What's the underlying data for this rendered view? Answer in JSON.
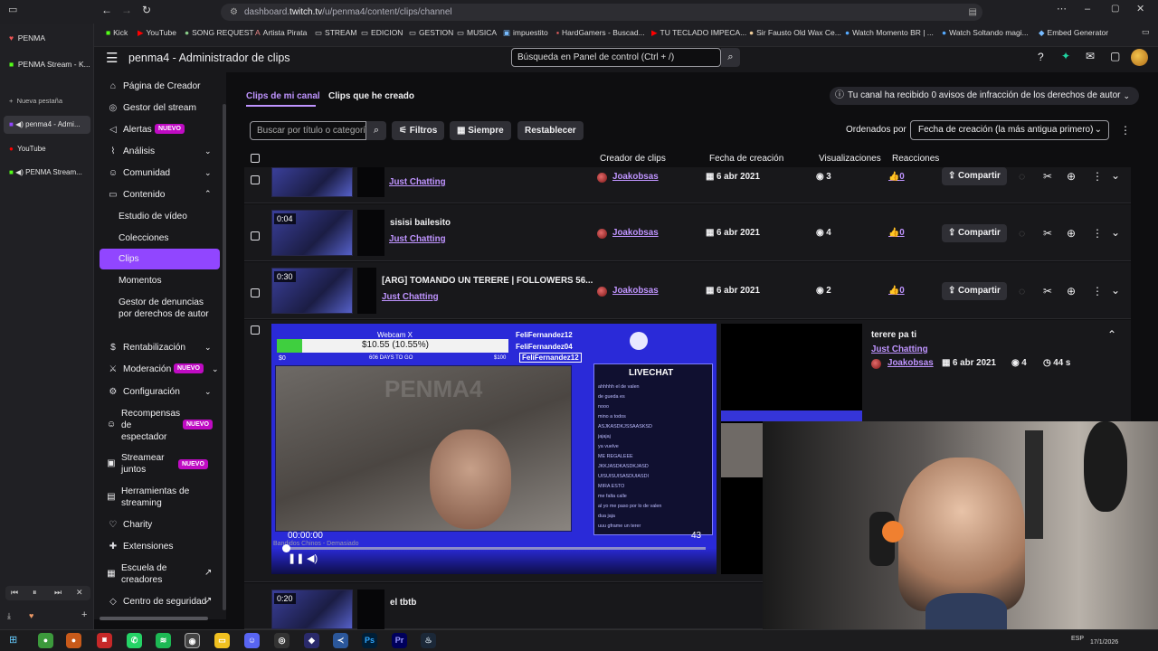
{
  "browser": {
    "url_prefix": "dashboard.",
    "url_host": "twitch.tv",
    "url_path": "/u/penma4/content/clips/channel",
    "bookmarks": [
      "Kick",
      "YouTube",
      "SONG REQUEST",
      "Artista Pirata",
      "STREAM",
      "EDICION",
      "GESTION",
      "MUSICA",
      "impuestito",
      "HardGamers - Buscad...",
      "TU TECLADO IMPECA...",
      "Sir Fausto Old Wax Ce...",
      "Watch Momento BR | ...",
      "Watch Soltando magi...",
      "Embed Generator"
    ]
  },
  "vtabs": {
    "profile": "PENMA",
    "tab1": "PENMA Stream - K...",
    "new_tab": "Nueva pestaña",
    "tab2": "penma4 - Admi...",
    "tab3": "YouTube",
    "tab4": "PENMA Stream..."
  },
  "header": {
    "title": "penma4 - Administrador de clips",
    "search_placeholder": "Búsqueda en Panel de control (Ctrl + /)"
  },
  "nav": {
    "creator_page": "Página de Creador",
    "stream_manager": "Gestor del stream",
    "alerts": "Alertas",
    "analysis": "Análisis",
    "community": "Comunidad",
    "content": "Contenido",
    "video_studio": "Estudio de vídeo",
    "collections": "Colecciones",
    "clips": "Clips",
    "moments": "Momentos",
    "copyright": "Gestor de denuncias por derechos de autor",
    "monetization": "Rentabilización",
    "moderation": "Moderación",
    "settings": "Configuración",
    "viewer_rewards": "Recompensas de espectador",
    "stream_together": "Streamear juntos",
    "tools": "Herramientas de streaming",
    "charity": "Charity",
    "extensions": "Extensiones",
    "creator_school": "Escuela de creadores",
    "security": "Centro de seguridad",
    "badge_new": "NUEVO"
  },
  "tabs": {
    "channel": "Clips de mi canal",
    "mine": "Clips que he creado",
    "notice": "Tu canal ha recibido 0 avisos de infracción de los derechos de autor"
  },
  "filters": {
    "search_placeholder": "Buscar por título o categoría",
    "filters": "Filtros",
    "always": "Siempre",
    "reset": "Restablecer",
    "sort_label": "Ordenados por",
    "sort_value": "Fecha de creación (la más antigua primero)"
  },
  "columns": {
    "creator": "Creador de clips",
    "date": "Fecha de creación",
    "views": "Visualizaciones",
    "reactions": "Reacciones"
  },
  "clips": [
    {
      "title": "",
      "category": "Just Chatting",
      "creator": "Joakobsas",
      "date": "6 abr 2021",
      "views": "3",
      "reactions": "0",
      "share": "Compartir",
      "duration": ""
    },
    {
      "title": "sisisi bailesito",
      "category": "Just Chatting",
      "creator": "Joakobsas",
      "date": "6 abr 2021",
      "views": "4",
      "reactions": "0",
      "share": "Compartir",
      "duration": "0:04"
    },
    {
      "title": "[ARG] TOMANDO UN TERERE | FOLLOWERS 56...",
      "category": "Just Chatting",
      "creator": "Joakobsas",
      "date": "6 abr 2021",
      "views": "2",
      "reactions": "0",
      "share": "Compartir",
      "duration": "0:30"
    }
  ],
  "expanded": {
    "title": "terere pa ti",
    "category": "Just Chatting",
    "creator": "Joakobsas",
    "date": "6 abr 2021",
    "views": "4",
    "duration": "44 s",
    "player": {
      "webcam": "Webcam X",
      "goal": "$10.55 (10.55%)",
      "goal_min": "$0",
      "goal_max": "$100",
      "days": "606 DAYS TO GO",
      "handle1": "FeliFernandez12",
      "handle2": "FeliFernandez04",
      "handle3": "FeliFernandez12",
      "watermark": "PENMA4",
      "livechat": "LIVECHAT",
      "time": "00:00:00",
      "remaining": "43",
      "song": "Bandidos Chinos - Demasiado",
      "chat": [
        "ahhhhh el de valen",
        "de gueda es",
        "nooo",
        "mino a todos",
        "ASJKASDKJSSAASKSD",
        "jajajaj",
        "ya vuelve",
        "ME REGALEEE",
        "JKKJASDKASDKJASD",
        "UISUISUISASDUIASDI",
        "MIRA ESTO",
        "me falta calle",
        "al yo me paso por lo de valen",
        "dua jaja",
        "uuu gframe un terer"
      ]
    }
  },
  "next_clip": {
    "title": "el tbtb",
    "duration": "0:20"
  },
  "taskbar": {
    "lang": "ESP",
    "date": "17/1/2026"
  },
  "colors": {
    "accent": "#9146ff",
    "link": "#bf94ff",
    "badge": "#bf0bc3",
    "bg": "#0e0e10",
    "panel": "#18181b"
  }
}
